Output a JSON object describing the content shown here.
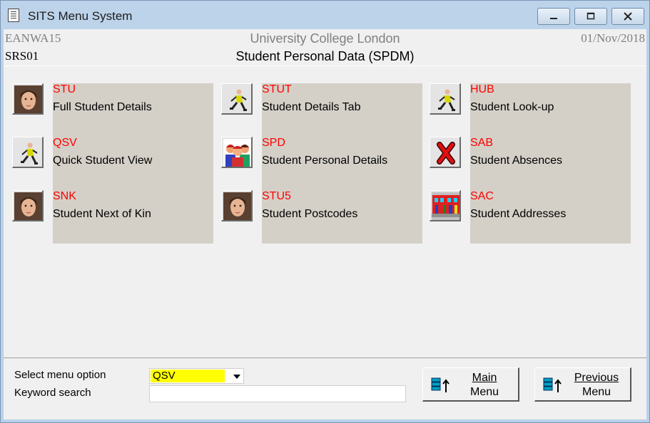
{
  "window": {
    "title": "SITS Menu System"
  },
  "header": {
    "user": "EANWA15",
    "institution": "University College London",
    "date": "01/Nov/2018",
    "menu_code": "SRS01",
    "menu_title": "Student Personal Data (SPDM)"
  },
  "menu_items": [
    {
      "code": "STU",
      "label": "Full Student Details",
      "icon": "student-photo-icon"
    },
    {
      "code": "QSV",
      "label": "Quick Student View",
      "icon": "running-person-icon"
    },
    {
      "code": "SNK",
      "label": "Student Next of Kin",
      "icon": "student-photo-icon"
    },
    {
      "code": "STUT",
      "label": "Student Details Tab",
      "icon": "running-person-icon"
    },
    {
      "code": "SPD",
      "label": "Student Personal Details",
      "icon": "people-group-icon"
    },
    {
      "code": "STU5",
      "label": "Student Postcodes",
      "icon": "student-photo-icon"
    },
    {
      "code": "HUB",
      "label": "Student Look-up",
      "icon": "running-person-icon"
    },
    {
      "code": "SAB",
      "label": "Student Absences",
      "icon": "red-cross-icon"
    },
    {
      "code": "SAC",
      "label": "Student Addresses",
      "icon": "houses-icon"
    }
  ],
  "bottom": {
    "select_label": "Select menu option",
    "select_value": "QSV",
    "keyword_label": "Keyword search",
    "keyword_value": "",
    "main_menu_line1": "Main",
    "main_menu_line2": "Menu",
    "previous_menu_line1": "Previous",
    "previous_menu_line2": "Menu"
  },
  "colors": {
    "code_text": "#ff0000",
    "column_background": "#d4d0c8",
    "select_highlight": "#ffff00",
    "titlebar": "#bcd3ea"
  }
}
